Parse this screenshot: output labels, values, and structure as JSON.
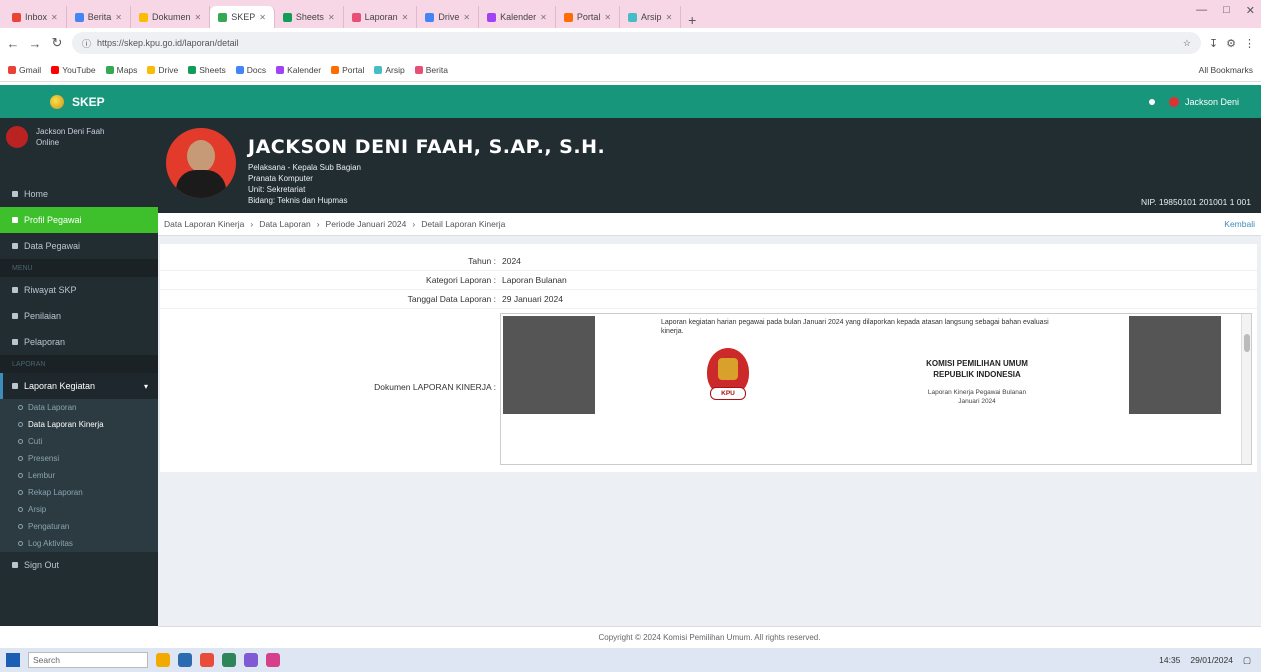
{
  "browser": {
    "tabs": [
      {
        "label": "Inbox",
        "color": "#ea4335"
      },
      {
        "label": "Berita",
        "color": "#4285f4"
      },
      {
        "label": "Dokumen",
        "color": "#fbbc05"
      },
      {
        "label": "SKEP",
        "color": "#34a853",
        "active": true
      },
      {
        "label": "Sheets",
        "color": "#0f9d58"
      },
      {
        "label": "Laporan",
        "color": "#e94e77"
      },
      {
        "label": "Drive",
        "color": "#4285f4"
      },
      {
        "label": "Kalender",
        "color": "#a142f4"
      },
      {
        "label": "Portal",
        "color": "#ff6d01"
      },
      {
        "label": "Arsip",
        "color": "#46bdc6"
      }
    ],
    "url": "https://skep.kpu.go.id/laporan/detail",
    "bookmarks": [
      {
        "label": "Gmail",
        "color": "#ea4335"
      },
      {
        "label": "YouTube",
        "color": "#ff0000"
      },
      {
        "label": "Maps",
        "color": "#34a853"
      },
      {
        "label": "Drive",
        "color": "#fbbc05"
      },
      {
        "label": "Sheets",
        "color": "#0f9d58"
      },
      {
        "label": "Docs",
        "color": "#4285f4"
      },
      {
        "label": "Kalender",
        "color": "#a142f4"
      },
      {
        "label": "Portal",
        "color": "#ff6d01"
      },
      {
        "label": "Arsip",
        "color": "#46bdc6"
      },
      {
        "label": "Berita",
        "color": "#e94e77"
      }
    ],
    "all_bookmarks": "All Bookmarks"
  },
  "app": {
    "brand": "SKEP",
    "user_name": "Jackson Deni",
    "accent": "#17967c"
  },
  "sidebar": {
    "user_line1": "Jackson Deni Faah",
    "user_line2": "Online",
    "items": [
      {
        "label": "Home",
        "type": "item"
      },
      {
        "label": "Profil Pegawai",
        "type": "item",
        "active": true
      },
      {
        "label": "Data Pegawai",
        "type": "item"
      },
      {
        "label": "MENU",
        "type": "header"
      },
      {
        "label": "Riwayat SKP",
        "type": "item"
      },
      {
        "label": "Penilaian",
        "type": "item"
      },
      {
        "label": "Pelaporan",
        "type": "item"
      },
      {
        "label": "LAPORAN",
        "type": "header"
      },
      {
        "label": "Laporan Kegiatan",
        "type": "open"
      },
      {
        "label": "Data Laporan",
        "type": "sub"
      },
      {
        "label": "Data Laporan Kinerja",
        "type": "sub",
        "current": true
      },
      {
        "label": "Cuti",
        "type": "sub"
      },
      {
        "label": "Presensi",
        "type": "sub"
      },
      {
        "label": "Lembur",
        "type": "sub"
      },
      {
        "label": "Rekap Laporan",
        "type": "sub"
      },
      {
        "label": "Arsip",
        "type": "sub"
      },
      {
        "label": "Pengaturan",
        "type": "sub"
      },
      {
        "label": "Log Aktivitas",
        "type": "sub"
      },
      {
        "label": "Sign Out",
        "type": "item"
      }
    ]
  },
  "profile": {
    "name": "JACKSON DENI FAAH, S.AP., S.H.",
    "line1": "Pelaksana - Kepala Sub Bagian",
    "line2": "Pranata Komputer",
    "line3": "Unit: Sekretariat",
    "line4": "Bidang: Teknis dan Hupmas",
    "nip": "NIP. 19850101 201001 1 001"
  },
  "breadcrumb": {
    "items": [
      "Data Laporan Kinerja",
      "Data Laporan",
      "Periode Januari 2024",
      "Detail Laporan Kinerja"
    ],
    "back": "Kembali"
  },
  "detail": {
    "rows": [
      {
        "label": "Tahun :",
        "value": "2024"
      },
      {
        "label": "Kategori Laporan :",
        "value": "Laporan Bulanan"
      },
      {
        "label": "Tanggal Data Laporan :",
        "value": "29 Januari 2024"
      }
    ],
    "doc_label": "Dokumen LAPORAN KINERJA :",
    "doc": {
      "note": "Laporan kegiatan harian pegawai pada bulan Januari 2024 yang dilaporkan kepada atasan langsung sebagai bahan evaluasi kinerja.",
      "badge": "KPU",
      "title_line1": "KOMISI PEMILIHAN UMUM",
      "title_line2": "REPUBLIK INDONESIA",
      "subtitle_line1": "Laporan Kinerja Pegawai Bulanan",
      "subtitle_line2": "Januari 2024"
    }
  },
  "footer": "Copyright © 2024 Komisi Pemilihan Umum. All rights reserved.",
  "taskbar": {
    "search_placeholder": "Search",
    "time": "14:35",
    "date": "29/01/2024",
    "apps": [
      "#f2a900",
      "#2b6cb0",
      "#e84d3c",
      "#2f855a",
      "#805ad5",
      "#d53f8c"
    ]
  }
}
